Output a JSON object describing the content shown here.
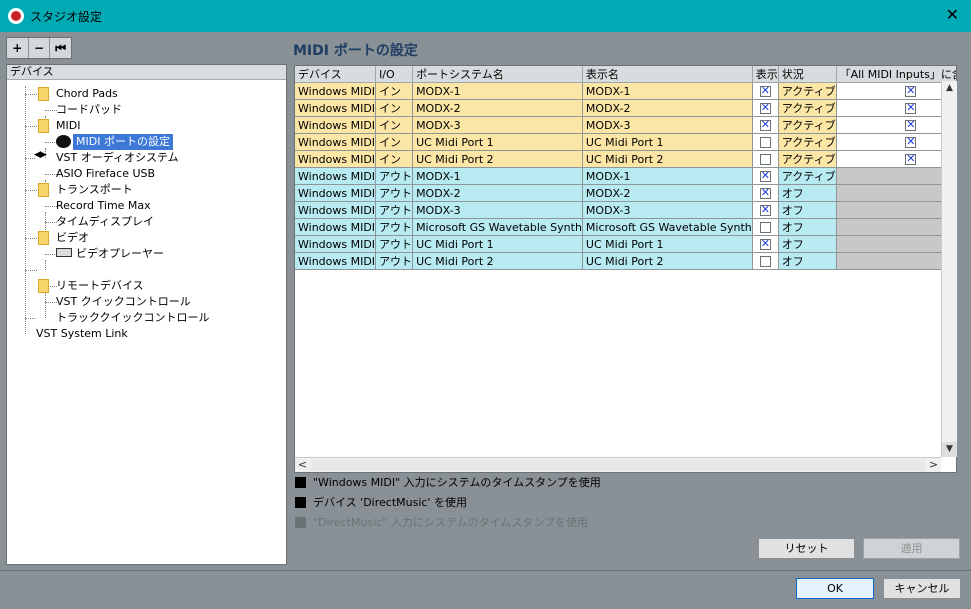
{
  "window": {
    "title": "スタジオ設定",
    "close_glyph": "✕"
  },
  "toolbar": {
    "add": "+",
    "remove": "−",
    "reset": "⏮"
  },
  "tree": {
    "header": "デバイス",
    "items": [
      {
        "label": "Chord Pads",
        "kind": "folder"
      },
      {
        "label": "コードパッド",
        "kind": "child"
      },
      {
        "label": "MIDI",
        "kind": "folder"
      },
      {
        "label": "MIDI ポートの設定",
        "kind": "selected"
      },
      {
        "label": "VST オーディオシステム",
        "kind": "top"
      },
      {
        "label": "ASIO Fireface USB",
        "kind": "child"
      },
      {
        "label": "トランスポート",
        "kind": "folder"
      },
      {
        "label": "Record Time Max",
        "kind": "child"
      },
      {
        "label": "タイムディスプレイ",
        "kind": "child"
      },
      {
        "label": "ビデオ",
        "kind": "folder"
      },
      {
        "label": "ビデオプレーヤー",
        "kind": "child"
      },
      {
        "label": "リモートデバイス",
        "kind": "folder"
      },
      {
        "label": "VST クイックコントロール",
        "kind": "child"
      },
      {
        "label": "トラッククイックコントロール",
        "kind": "child"
      },
      {
        "label": "VST System Link",
        "kind": "top"
      }
    ]
  },
  "main": {
    "title": "MIDI ポートの設定",
    "columns": [
      "デバイス",
      "I/O",
      "ポートシステム名",
      "表示名",
      "表示",
      "状況",
      "「All MIDI Inputs」に含める"
    ],
    "rows": [
      {
        "device": "Windows MIDI",
        "io": "イン",
        "port": "MODX-1",
        "display": "MODX-1",
        "visible": true,
        "status": "アクティブ",
        "all_inputs": true,
        "dir": "in"
      },
      {
        "device": "Windows MIDI",
        "io": "イン",
        "port": "MODX-2",
        "display": "MODX-2",
        "visible": true,
        "status": "アクティブ",
        "all_inputs": true,
        "dir": "in"
      },
      {
        "device": "Windows MIDI",
        "io": "イン",
        "port": "MODX-3",
        "display": "MODX-3",
        "visible": true,
        "status": "アクティブ",
        "all_inputs": true,
        "dir": "in"
      },
      {
        "device": "Windows MIDI",
        "io": "イン",
        "port": "UC Midi Port 1",
        "display": "UC Midi Port 1",
        "visible": false,
        "status": "アクティブ",
        "all_inputs": true,
        "dir": "in"
      },
      {
        "device": "Windows MIDI",
        "io": "イン",
        "port": "UC Midi Port 2",
        "display": "UC Midi Port 2",
        "visible": false,
        "status": "アクティブ",
        "all_inputs": true,
        "dir": "in"
      },
      {
        "device": "Windows MIDI",
        "io": "アウト",
        "port": "MODX-1",
        "display": "MODX-1",
        "visible": true,
        "status": "アクティブ",
        "all_inputs": null,
        "dir": "out"
      },
      {
        "device": "Windows MIDI",
        "io": "アウト",
        "port": "MODX-2",
        "display": "MODX-2",
        "visible": true,
        "status": "オフ",
        "all_inputs": null,
        "dir": "out"
      },
      {
        "device": "Windows MIDI",
        "io": "アウト",
        "port": "MODX-3",
        "display": "MODX-3",
        "visible": true,
        "status": "オフ",
        "all_inputs": null,
        "dir": "out"
      },
      {
        "device": "Windows MIDI",
        "io": "アウト",
        "port": "Microsoft GS Wavetable Synth",
        "display": "Microsoft GS Wavetable Synth",
        "visible": false,
        "status": "オフ",
        "all_inputs": null,
        "dir": "out"
      },
      {
        "device": "Windows MIDI",
        "io": "アウト",
        "port": "UC Midi Port 1",
        "display": "UC Midi Port 1",
        "visible": true,
        "status": "オフ",
        "all_inputs": null,
        "dir": "out"
      },
      {
        "device": "Windows MIDI",
        "io": "アウト",
        "port": "UC Midi Port 2",
        "display": "UC Midi Port 2",
        "visible": false,
        "status": "オフ",
        "all_inputs": null,
        "dir": "out"
      }
    ]
  },
  "scroll": {
    "up": "▲",
    "down": "▼",
    "left": "<",
    "right": ">"
  },
  "options": {
    "opt1": "\"Windows MIDI\" 入力にシステムのタイムスタンプを使用",
    "opt2": "デバイス 'DirectMusic' を使用",
    "opt3": "\"DirectMusic\" 入力にシステムのタイムスタンプを使用"
  },
  "buttons": {
    "reset": "リセット",
    "apply": "適用",
    "ok": "OK",
    "cancel": "キャンセル"
  },
  "colors": {
    "titlebar": "#00aab4",
    "input_row": "#fce6a6",
    "output_row": "#b8eaf2",
    "check": "#1d3fd8"
  }
}
